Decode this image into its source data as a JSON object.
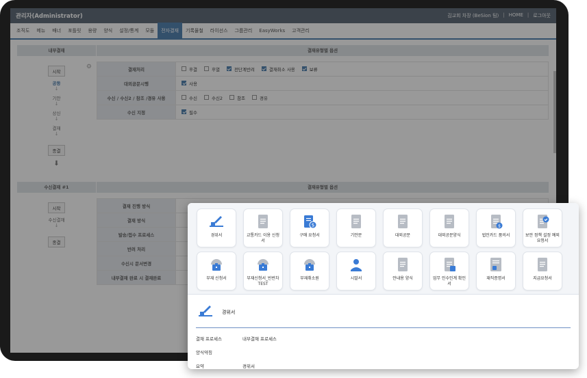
{
  "app": {
    "title": "관리자(Administrator)",
    "user": "김교회 차장 (BeSion 팀)",
    "home": "HOME",
    "logout": "로그아웃"
  },
  "menu": [
    "조직도",
    "메뉴",
    "배너",
    "포틀릿",
    "용량",
    "양식",
    "설정/통계",
    "모듈",
    "전자결재",
    "기록물철",
    "라이선스",
    "그룹관리",
    "EasyWorks",
    "고객관리"
  ],
  "menu_active_index": 8,
  "section1": {
    "left_header": "내부결재",
    "right_header": "결재유형별 옵션",
    "start_label": "시작",
    "flow": [
      "공동",
      "기안",
      "상신",
      "결재"
    ],
    "end_label": "종결",
    "rows": [
      {
        "label": "결재처리",
        "options": [
          {
            "text": "후결",
            "checked": false
          },
          {
            "text": "후열",
            "checked": false
          },
          {
            "text": "전단계반려",
            "checked": true
          },
          {
            "text": "결재취소 사용",
            "checked": true
          },
          {
            "text": "보류",
            "checked": true
          }
        ]
      },
      {
        "label": "대외공문시행",
        "options": [
          {
            "text": "사용",
            "checked": true
          }
        ]
      },
      {
        "label": "수신 / 수신2 / 참조 /경유 사용",
        "options": [
          {
            "text": "수신",
            "checked": false
          },
          {
            "text": "수신2",
            "checked": false
          },
          {
            "text": "참조",
            "checked": false
          },
          {
            "text": "경유",
            "checked": false
          }
        ]
      },
      {
        "label": "수신 지정",
        "options": [
          {
            "text": "필수",
            "checked": true
          }
        ]
      }
    ]
  },
  "section2": {
    "left_header": "수신결재 #1",
    "right_header": "결재유형별 옵션",
    "start_label": "시작",
    "flow": [
      "수신결재"
    ],
    "end_label": "종결",
    "rows": [
      "결재 진행 방식",
      "결재 방식",
      "발송/접수 프로세스",
      "반려 처리",
      "수신시 문서변경",
      "내부결재 완료 시 결재완료"
    ]
  },
  "popup": {
    "tiles": [
      {
        "name": "경위서",
        "icon": "pen-icon"
      },
      {
        "name": "교통카드 이용 신청서",
        "icon": "document-icon"
      },
      {
        "name": "구매 요청서",
        "icon": "purchase-icon"
      },
      {
        "name": "기안문",
        "icon": "document-icon"
      },
      {
        "name": "대외공문",
        "icon": "document-icon"
      },
      {
        "name": "대외공문양식",
        "icon": "document-icon"
      },
      {
        "name": "법인카드 품의서",
        "icon": "card-doc-icon"
      },
      {
        "name": "보안 정책 설정 예외 요청서",
        "icon": "security-doc-icon"
      },
      {
        "name": "부재 신청서",
        "icon": "briefcase-icon"
      },
      {
        "name": "부재신청서_반반차 TEST",
        "icon": "briefcase-icon"
      },
      {
        "name": "부재취소원",
        "icon": "briefcase-icon"
      },
      {
        "name": "시말서",
        "icon": "person-icon"
      },
      {
        "name": "안내용 양식",
        "icon": "document-icon"
      },
      {
        "name": "업무 인수인계 확인서",
        "icon": "handover-icon"
      },
      {
        "name": "재직증명서",
        "icon": "certificate-icon"
      },
      {
        "name": "지급요청서",
        "icon": "document-icon"
      }
    ],
    "selected": {
      "name": "경위서",
      "fields": [
        {
          "key": "결재 프로세스",
          "value": "내부결재 프로세스"
        },
        {
          "key": "양식약칭",
          "value": ""
        },
        {
          "key": "요약",
          "value": "경위서"
        }
      ]
    }
  },
  "colors": {
    "primary": "#1d5d9a",
    "topbar": "#2f3f50",
    "icon_blue": "#3a7bd5",
    "icon_gray": "#b7bcc4"
  }
}
